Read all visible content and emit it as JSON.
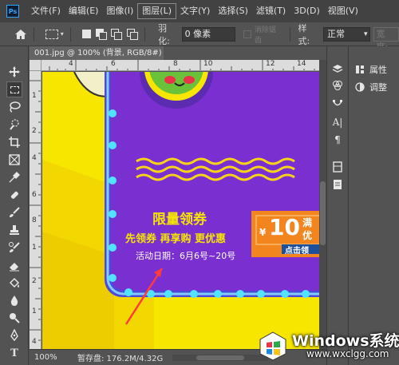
{
  "app": {
    "logo_text": "Ps"
  },
  "menu": [
    "文件(F)",
    "编辑(E)",
    "图像(I)",
    "图层(L)",
    "文字(Y)",
    "选择(S)",
    "滤镜(T)",
    "3D(D)",
    "视图(V)"
  ],
  "options": {
    "feather_label": "羽化:",
    "feather_value": "0 像素",
    "antialias_label": "消除锯齿",
    "style_label": "样式:",
    "style_value": "正常",
    "width_label": "宽度:"
  },
  "document": {
    "tab_title": "001.jpg @ 100% (背景, RGB/8#) *",
    "close_glyph": "×"
  },
  "rulers": {
    "top": [
      "4",
      "6",
      "8",
      "10",
      "12",
      "14"
    ],
    "left": [
      "1",
      "2",
      "4",
      "6",
      "8",
      "1",
      "2",
      "1",
      "4"
    ]
  },
  "canvas": {
    "headline": "限量领券",
    "subline": "先领券 再享购 更优惠",
    "date_text": "活动日期：6月6号~20号",
    "coupon_symbol": "¥",
    "coupon_amount": "10",
    "coupon_side1": "满",
    "coupon_side2": "优",
    "coupon_button": "点击领"
  },
  "panels": {
    "properties_label": "属性",
    "adjustments_label": "调整"
  },
  "status": {
    "zoom": "100%",
    "doc_info": "暂存盘: 176.2M/4.32G"
  },
  "watermark": {
    "title": "Windows系统城",
    "url": "www.wxclgg.com"
  },
  "colors": {
    "purple": "#7a2fd0",
    "yellow": "#f7e600",
    "orange": "#f3851f",
    "neon_blue": "#2ec7ff",
    "coupon_blue": "#1e4f9a"
  }
}
